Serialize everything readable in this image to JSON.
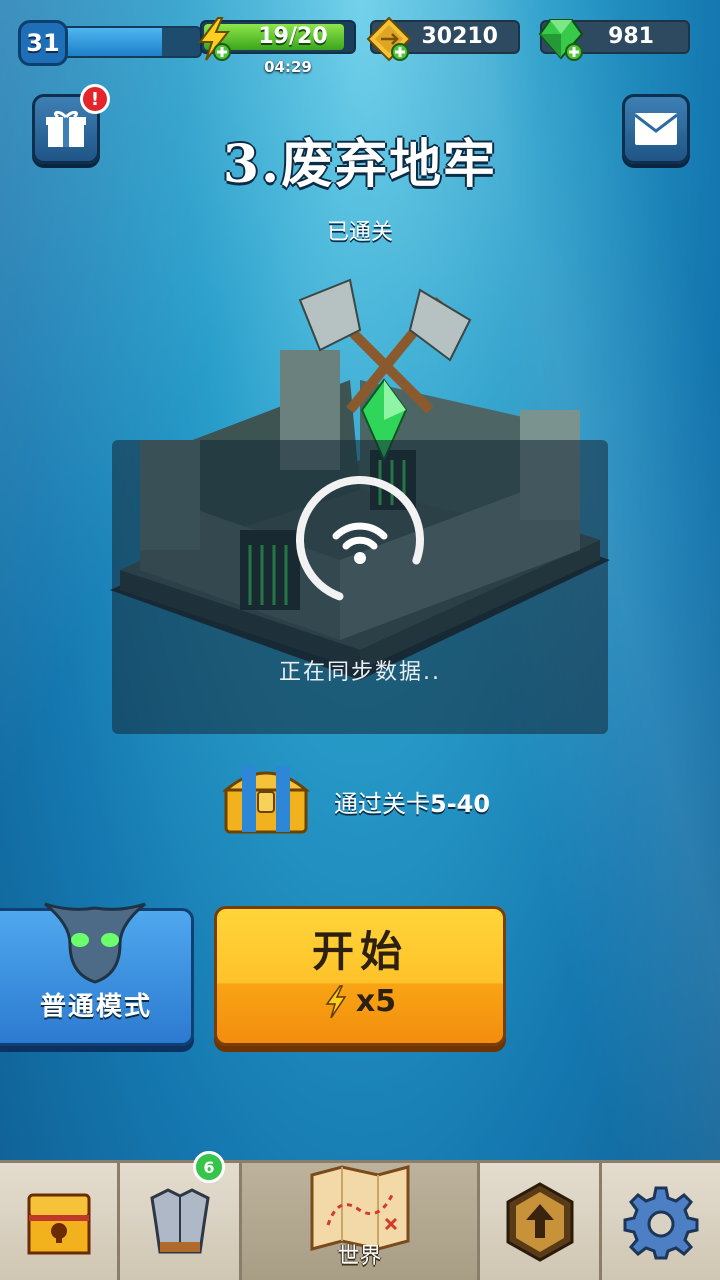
{
  "hud": {
    "level": "31",
    "level_progress": 0.75,
    "energy": "19/20",
    "energy_progress": 0.95,
    "energy_timer": "04:29",
    "coins": "30210",
    "gems": "981"
  },
  "stage": {
    "title": "3.废弃地牢",
    "status": "已通关"
  },
  "sync": {
    "text": "正在同步数据.."
  },
  "reward": {
    "prefix": "通过关卡",
    "range": "5-40"
  },
  "mode": {
    "label": "普通模式"
  },
  "start": {
    "label": "开始",
    "cost": "x5"
  },
  "nav": {
    "items": [
      {
        "name": "chest"
      },
      {
        "name": "equipment",
        "badge": "6"
      },
      {
        "name": "world",
        "label": "世界"
      },
      {
        "name": "upgrade"
      },
      {
        "name": "settings"
      }
    ]
  },
  "colors": {
    "energy_green": "#3aa51c",
    "start_yellow": "#ffc22a",
    "mode_blue": "#2c7ad0",
    "alert_red": "#e3262b",
    "badge_green": "#36c44a"
  },
  "icons": [
    "gift-icon",
    "mail-icon",
    "lightning-icon",
    "coin-icon",
    "gem-icon",
    "wifi-icon",
    "chest-icon",
    "demon-mask-icon",
    "armor-icon",
    "map-icon",
    "upgrade-arrow-icon",
    "gear-icon"
  ]
}
